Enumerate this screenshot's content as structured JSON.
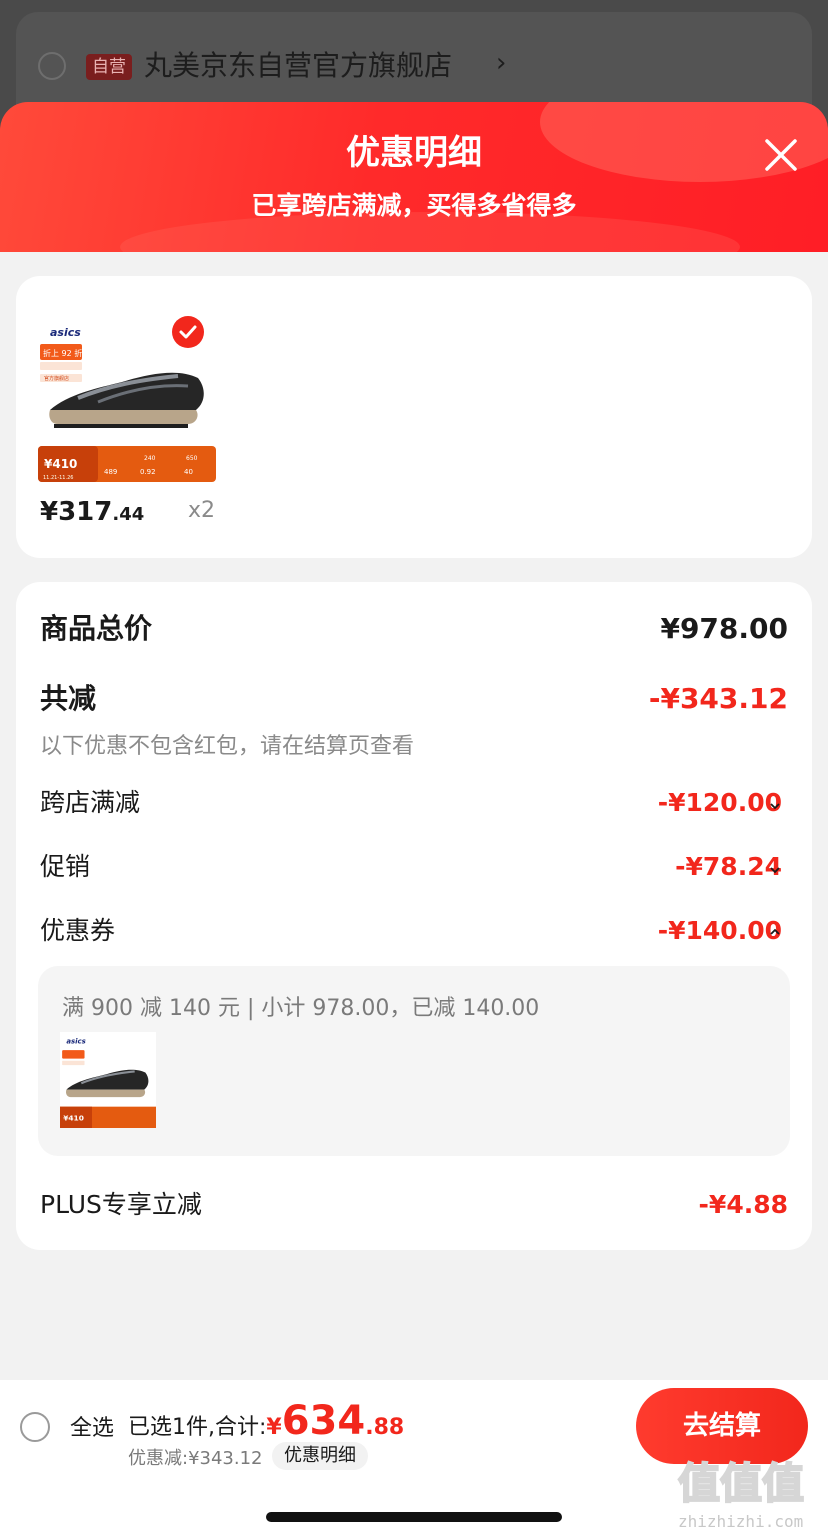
{
  "background_store": {
    "tag": "自营",
    "name": "丸美京东自营官方旗舰店",
    "chevron": "›"
  },
  "sheet": {
    "title": "优惠明细",
    "subtitle": "已享跨店满减，买得多省得多",
    "close_icon": "close-icon"
  },
  "product": {
    "brand": "asics",
    "badge_discount": "折上 92 折",
    "badge_store": "官方旗舰店",
    "strip_price": "¥410",
    "strip_dates": "11.21-11.26",
    "strip_values": [
      "240",
      "489",
      "0.92",
      "40",
      "650"
    ],
    "price_int": "¥317",
    "price_dec": ".44",
    "quantity": "x2",
    "selected": true
  },
  "details": {
    "total_label": "商品总价",
    "total_value": "¥978.00",
    "reduce_label": "共减",
    "reduce_value": "-¥343.12",
    "note": "以下优惠不包含红包，请在结算页查看",
    "rows": [
      {
        "label": "跨店满减",
        "value": "-¥120.00",
        "expanded": false
      },
      {
        "label": "促销",
        "value": "-¥78.24",
        "expanded": false
      },
      {
        "label": "优惠券",
        "value": "-¥140.00",
        "expanded": true
      }
    ],
    "coupon_detail": "满 900 减 140 元 | 小计 978.00，已减 140.00",
    "plus_label": "PLUS专享立减",
    "plus_value": "-¥4.88"
  },
  "bottom_bar": {
    "select_all": "全选",
    "selected_prefix": "已选1件,合计:",
    "total_symbol": "¥",
    "total_int": "634",
    "total_dec": ".88",
    "discount_info": "优惠减:¥343.12",
    "discount_detail_button": "优惠明细",
    "checkout_button": "去结算"
  },
  "watermark": {
    "site": "zhizhizhi.com",
    "mark": "值值值"
  },
  "colors": {
    "accent": "#f2271c",
    "header_gradient_start": "#ff4a3a",
    "header_gradient_end": "#ff1e26"
  }
}
